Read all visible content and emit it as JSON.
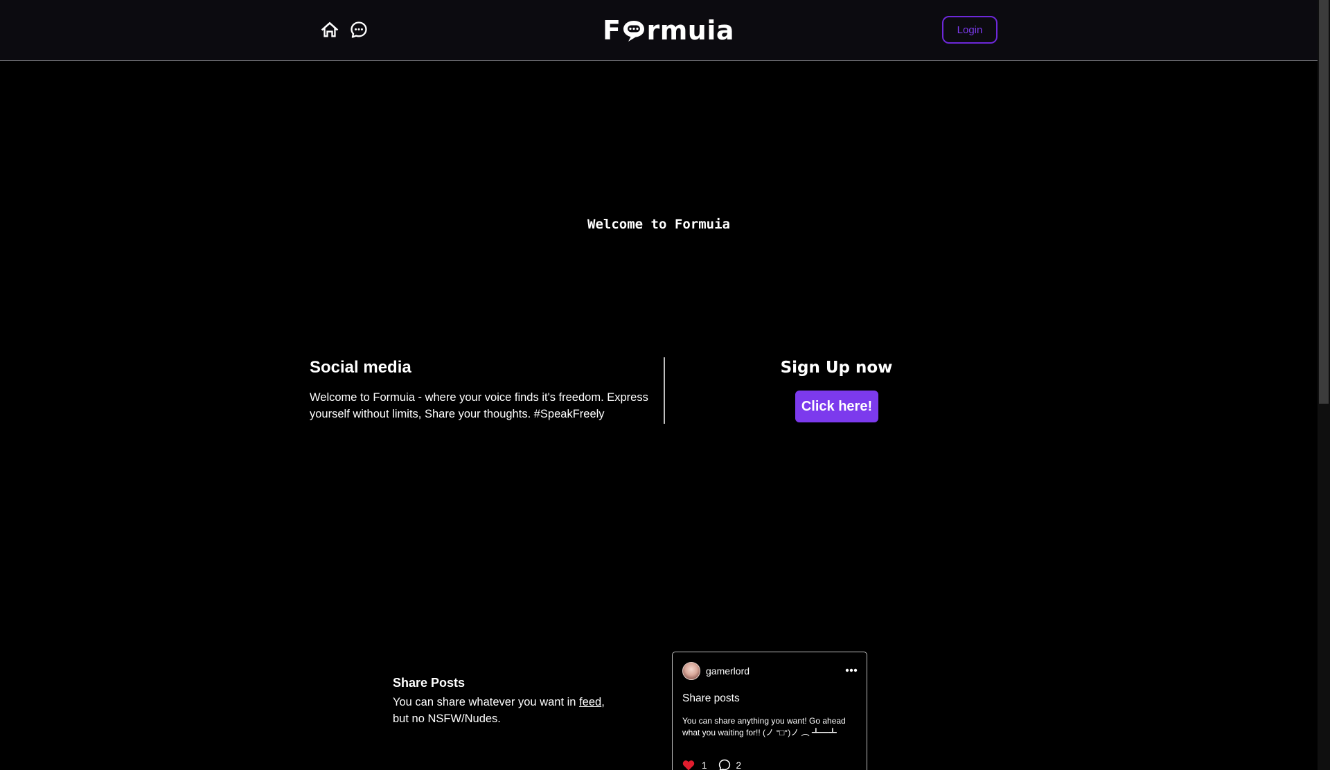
{
  "header": {
    "logo_before": "F",
    "logo_after": "rmuia",
    "login_label": "Login"
  },
  "hero": {
    "welcome": "Welcome to Formuia"
  },
  "info": {
    "title": "Social media",
    "text": "Welcome to Formuia - where your voice finds it's freedom. Express yourself without limits, Share your thoughts. #SpeakFreely"
  },
  "signup": {
    "title": "Sign Up now",
    "button_label": "Click here!"
  },
  "feature": {
    "title": "Share Posts",
    "text_before": "You can share whatever you want in ",
    "link_text": "feed",
    "text_after": ", but no NSFW/Nudes."
  },
  "post": {
    "username": "gamerlord",
    "title": "Share posts",
    "body": "You can share anything you want! Go ahead what you waiting for!! (ノ °□°)ノ ︵ ┻━┻",
    "likes": "1",
    "comments": "2"
  },
  "colors": {
    "accent": "#7c3aed",
    "header_bg": "#0c0b10",
    "page_bg": "#000000",
    "like_red": "#e11d2e"
  },
  "icons": {
    "home": "home-icon",
    "chat": "chat-bubble-icon",
    "more": "more-horizontal-icon",
    "like": "heart-icon",
    "comment": "comment-icon"
  }
}
